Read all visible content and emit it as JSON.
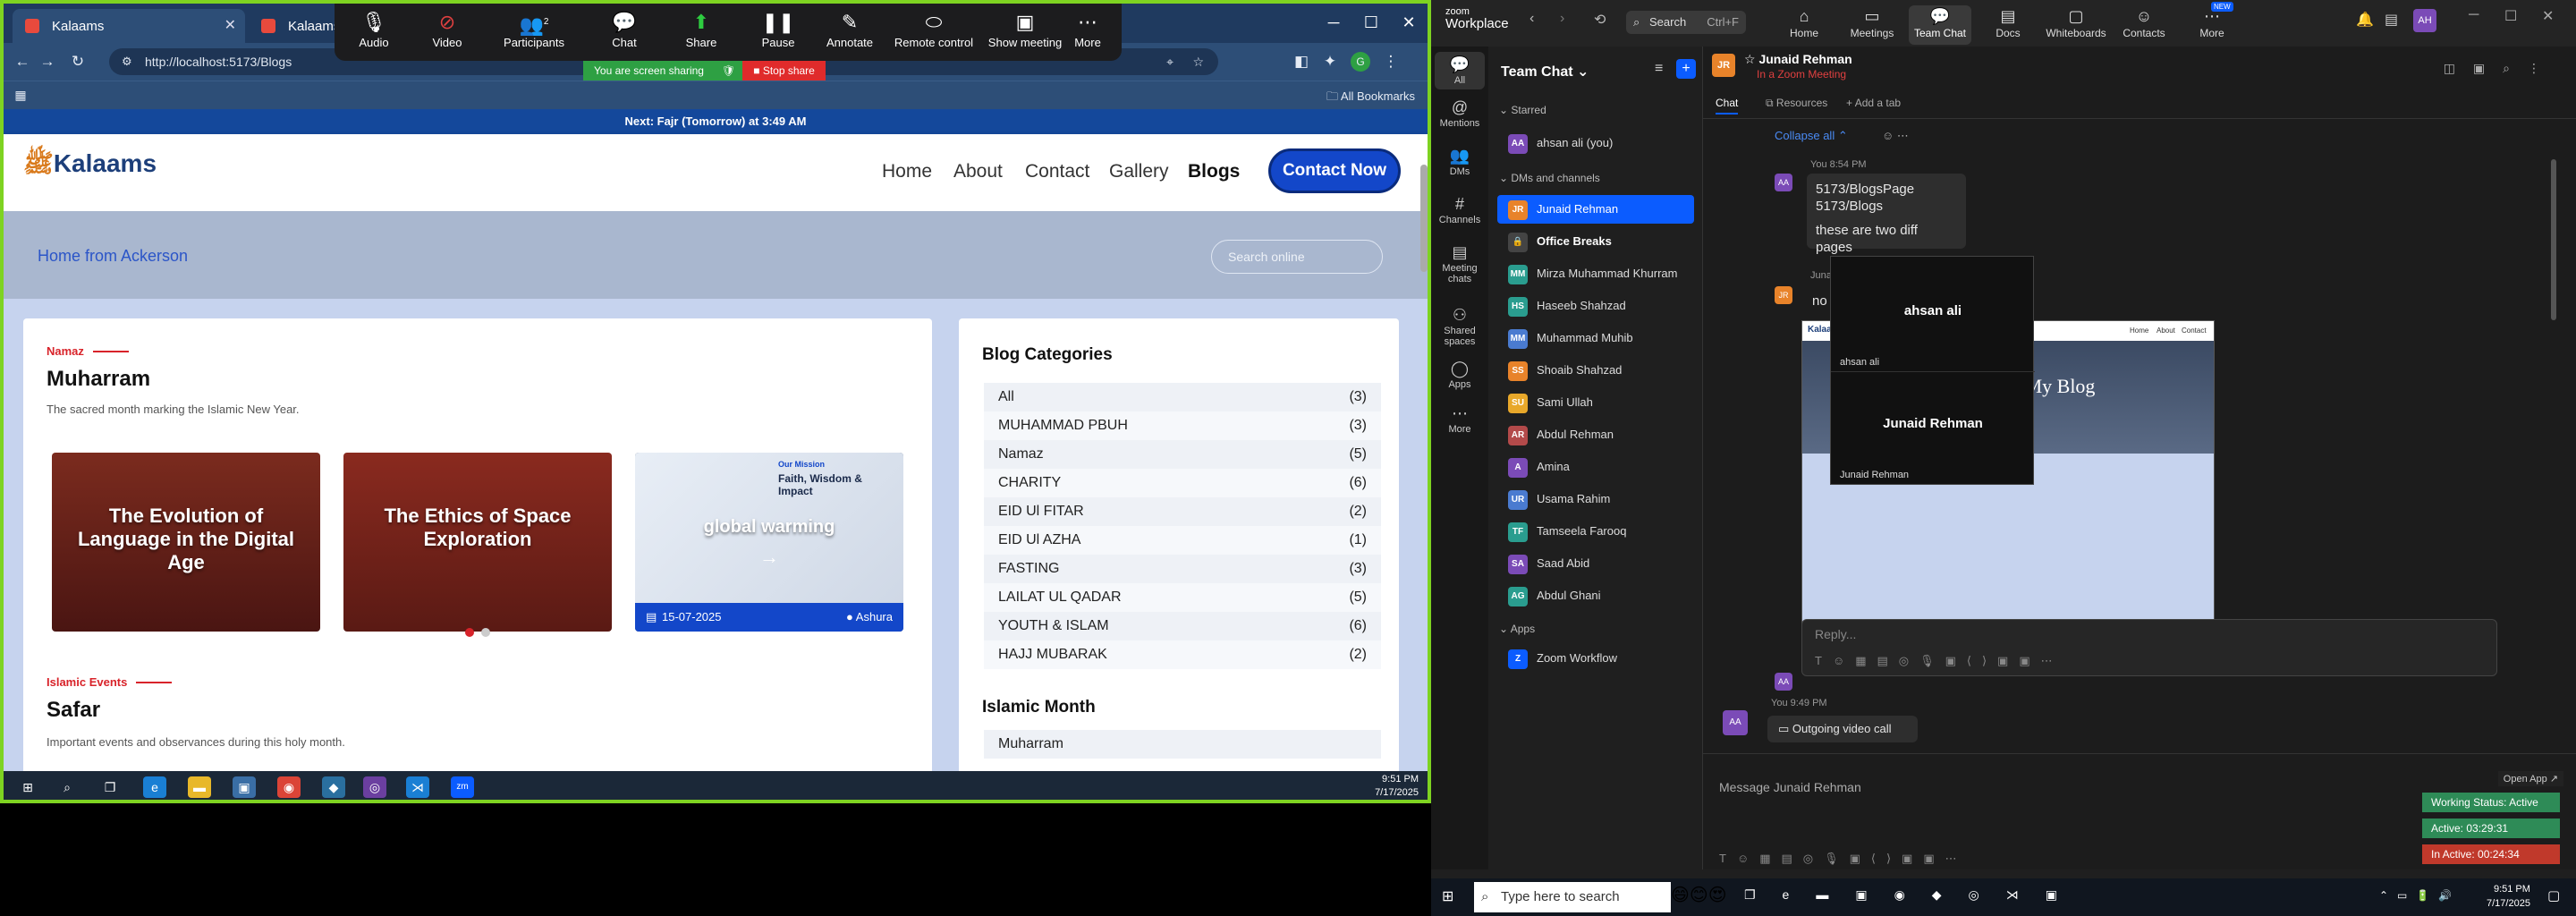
{
  "browser": {
    "tabs": [
      {
        "title": "Kalaams"
      },
      {
        "title": "Kalaams"
      }
    ],
    "url": "http://localhost:5173/Blogs",
    "bookmarks_label": "All Bookmarks"
  },
  "zoom_toolbar": {
    "items": [
      {
        "label": "Audio",
        "icon": "mic-icon"
      },
      {
        "label": "Video",
        "icon": "video-off-icon"
      },
      {
        "label": "Participants",
        "icon": "participants-icon",
        "badge": "2"
      },
      {
        "label": "Chat",
        "icon": "chat-icon"
      },
      {
        "label": "Share",
        "icon": "share-icon"
      },
      {
        "label": "Pause",
        "icon": "pause-icon"
      },
      {
        "label": "Annotate",
        "icon": "annotate-icon"
      },
      {
        "label": "Remote control",
        "icon": "remote-control-icon"
      },
      {
        "label": "Show meeting",
        "icon": "show-meeting-icon"
      },
      {
        "label": "More",
        "icon": "more-icon"
      }
    ],
    "sharing_text": "You are screen sharing",
    "stop_share": "Stop share"
  },
  "site": {
    "prayer_bar": "Next: Fajr (Tomorrow) at 3:49 AM",
    "logo": "Kalaams",
    "nav": [
      "Home",
      "About",
      "Contact",
      "Gallery",
      "Blogs"
    ],
    "cta": "Contact Now",
    "breadcrumb": "Home from Ackerson",
    "search_placeholder": "Search online",
    "section1": {
      "label": "Namaz",
      "title": "Muharram",
      "desc": "The sacred month marking the Islamic New Year."
    },
    "blogs": [
      {
        "title": "The Evolution of Language in the Digital Age"
      },
      {
        "title": "The Ethics of Space Exploration"
      },
      {
        "title": "global warming",
        "date": "15-07-2025",
        "tag": "Ashura",
        "inner_title": "Faith, Wisdom & Impact",
        "inner_label": "Our Mission"
      }
    ],
    "section2": {
      "label": "Islamic Events",
      "title": "Safar",
      "desc": "Important events and observances during this holy month."
    },
    "categories_title": "Blog Categories",
    "categories": [
      {
        "name": "All",
        "count": "(3)"
      },
      {
        "name": "MUHAMMAD PBUH",
        "count": "(3)"
      },
      {
        "name": "Namaz",
        "count": "(5)"
      },
      {
        "name": "CHARITY",
        "count": "(6)"
      },
      {
        "name": "EID Ul FITAR",
        "count": "(2)"
      },
      {
        "name": "EID Ul AZHA",
        "count": "(1)"
      },
      {
        "name": "FASTING",
        "count": "(3)"
      },
      {
        "name": "LAILAT UL QADAR",
        "count": "(5)"
      },
      {
        "name": "YOUTH & ISLAM",
        "count": "(6)"
      },
      {
        "name": "HAJJ MUBARAK",
        "count": "(2)"
      }
    ],
    "month_title": "Islamic Month",
    "month_first": "Muharram"
  },
  "left_taskbar": {
    "time": "9:51 PM",
    "date": "7/17/2025"
  },
  "zoom_app": {
    "brand_top": "zoom",
    "brand": "Workplace",
    "search": "Search",
    "search_shortcut": "Ctrl+F",
    "top_nav": [
      {
        "label": "Home",
        "icon": "home-icon"
      },
      {
        "label": "Meetings",
        "icon": "meetings-icon"
      },
      {
        "label": "Team Chat",
        "icon": "team-chat-icon"
      },
      {
        "label": "Docs",
        "icon": "docs-icon"
      },
      {
        "label": "Whiteboards",
        "icon": "whiteboards-icon"
      },
      {
        "label": "Contacts",
        "icon": "contacts-icon"
      },
      {
        "label": "More",
        "icon": "more-icon",
        "badge": "NEW"
      }
    ],
    "avatar": "AH",
    "rail": [
      {
        "label": "All",
        "icon": "chat-bubble-icon"
      },
      {
        "label": "Mentions",
        "icon": "mention-icon"
      },
      {
        "label": "DMs",
        "icon": "dms-icon"
      },
      {
        "label": "Channels",
        "icon": "channels-icon"
      },
      {
        "label": "Meeting chats",
        "icon": "meeting-chats-icon"
      },
      {
        "label": "Shared spaces",
        "icon": "shared-spaces-icon"
      },
      {
        "label": "Apps",
        "icon": "apps-icon"
      },
      {
        "label": "More",
        "icon": "more-icon"
      }
    ],
    "list_title": "Team Chat",
    "starred_label": "Starred",
    "starred": [
      {
        "name": "ahsan ali (you)",
        "av": "AA",
        "color": "#7b4bb7"
      }
    ],
    "dms_label": "DMs and channels",
    "dms": [
      {
        "name": "Junaid Rehman",
        "av": "JR",
        "color": "#e8832a"
      },
      {
        "name": "Office Breaks",
        "av": "🔒",
        "color": "#444"
      },
      {
        "name": "Mirza Muhammad Khurram",
        "av": "MM",
        "color": "#2a9d8f"
      },
      {
        "name": "Haseeb Shahzad",
        "av": "HS",
        "color": "#2a9d8f"
      },
      {
        "name": "Muhammad Muhib",
        "av": "MM",
        "color": "#4a7bd0"
      },
      {
        "name": "Shoaib Shahzad",
        "av": "SS",
        "color": "#e8832a"
      },
      {
        "name": "Sami Ullah",
        "av": "SU",
        "color": "#e8a82a"
      },
      {
        "name": "Abdul Rehman",
        "av": "AR",
        "color": "#b34a4a"
      },
      {
        "name": "Amina",
        "av": "A",
        "color": "#7b4bb7"
      },
      {
        "name": "Usama Rahim",
        "av": "UR",
        "color": "#4a7bd0"
      },
      {
        "name": "Tamseela Farooq",
        "av": "TF",
        "color": "#2a9d8f"
      },
      {
        "name": "Saad Abid",
        "av": "SA",
        "color": "#7b4bb7"
      },
      {
        "name": "Abdul Ghani",
        "av": "AG",
        "color": "#2a9d8f"
      }
    ],
    "apps_label": "Apps",
    "apps": [
      {
        "name": "Zoom Workflow",
        "av": "Z",
        "color": "#0b5cff"
      }
    ],
    "chat_header": {
      "name": "Junaid Rehman",
      "status": "In a Zoom Meeting"
    },
    "chat_tabs": [
      "Chat",
      "Resources",
      "Add a tab"
    ],
    "collapse": "Collapse all",
    "messages": [
      {
        "meta": "You 8:54 PM",
        "lines": [
          "5173/BlogsPage",
          "5173/Blogs",
          "",
          "these are two diff pages"
        ]
      },
      {
        "meta": "Junaid Rehman 9:02 PM",
        "lines": [
          "no data disply"
        ]
      }
    ],
    "screenshot_title": "Welcome To My Blog",
    "screenshot_logo": "Kalaams",
    "screenshot_nav": [
      "Home",
      "About",
      "Contact"
    ],
    "video_tiles": [
      {
        "name": "ahsan ali",
        "label": "ahsan ali"
      },
      {
        "name": "Junaid Rehman",
        "label": "Junaid Rehman"
      }
    ],
    "reply_placeholder": "Reply...",
    "call_meta": "You 9:49 PM",
    "call_text": "Outgoing video call",
    "open_app": "Open App",
    "message_placeholder": "Message Junaid Rehman",
    "status": [
      {
        "text": "Working Status: Active",
        "color": "#2e8b57"
      },
      {
        "text": "Active: 03:29:31",
        "color": "#2e8b57"
      },
      {
        "text": "In Active: 00:24:34",
        "color": "#c0392b"
      }
    ]
  },
  "win_taskbar": {
    "search": "Type here to search",
    "time": "9:51 PM",
    "date": "7/17/2025"
  }
}
